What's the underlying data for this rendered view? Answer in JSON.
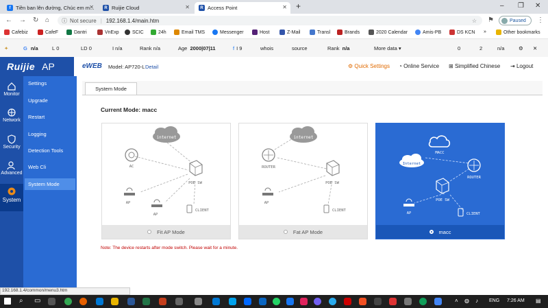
{
  "browser": {
    "tabs": [
      {
        "title": "Tiền ban lên đường, Chúc em m...",
        "icon": "facebook-icon",
        "color": "#1877f2",
        "active": false
      },
      {
        "title": "Ruijie Cloud",
        "icon": "ruijie-icon",
        "color": "#1e50a8",
        "active": false
      },
      {
        "title": "Access Point",
        "icon": "ruijie-icon",
        "color": "#1e50a8",
        "active": true
      }
    ],
    "address": {
      "security": "Not secure",
      "url": "192.168.1.4/main.htm"
    },
    "profile_status": "Paused",
    "bookmarks": [
      "Cafebiz",
      "CafeF",
      "Dantri",
      "VnExp",
      "SCIC",
      "24h",
      "Email TMS",
      "Messenger",
      "Host",
      "Z-Mail",
      "Transl",
      "Brands",
      "2020 Calendar",
      "Amis-PB",
      "DS KCN"
    ],
    "other_bookmarks": "Other bookmarks",
    "status_url": "192.168.1.4/common/menu3.htm"
  },
  "seobar": {
    "items": [
      {
        "label": "",
        "value": "n/a",
        "icon": "google-icon"
      },
      {
        "label": "L",
        "value": "0"
      },
      {
        "label": "LD",
        "value": "0"
      },
      {
        "label": "",
        "value": "I n/a"
      },
      {
        "label": "Rank",
        "value": "n/a"
      },
      {
        "label": "Age",
        "value": "2000|07|11"
      },
      {
        "label": "",
        "value": "I 9"
      },
      {
        "label": "",
        "value": "whois"
      },
      {
        "label": "",
        "value": "source"
      },
      {
        "label": "Rank",
        "value": "n/a"
      }
    ],
    "more": "More data",
    "right": [
      "0",
      "2",
      "n/a"
    ]
  },
  "app": {
    "brand": "Ruijie",
    "brand_suffix": "AP",
    "eweb": "eWEB",
    "model_label": "Model: AP720-L",
    "detail": "Detail",
    "header_links": {
      "quick": "Quick Settings",
      "online": "Online Service",
      "language": "Simplified Chinese",
      "logout": "Logout"
    },
    "rail": [
      {
        "label": "Monitor",
        "icon": "monitor-icon"
      },
      {
        "label": "Network",
        "icon": "network-icon"
      },
      {
        "label": "Security",
        "icon": "security-icon"
      },
      {
        "label": "Advanced",
        "icon": "advanced-icon"
      },
      {
        "label": "System",
        "icon": "system-icon",
        "selected": true
      }
    ],
    "submenu": [
      {
        "label": "Settings"
      },
      {
        "label": "Upgrade"
      },
      {
        "label": "Restart"
      },
      {
        "label": "Logging"
      },
      {
        "label": "Detection Tools"
      },
      {
        "label": "Web Cli"
      },
      {
        "label": "System Mode",
        "selected": true
      }
    ],
    "tab": "System Mode",
    "current_mode_label": "Current Mode:",
    "current_mode_value": "macc",
    "cards": [
      {
        "label": "Fit AP Mode",
        "selected": false,
        "diagram": {
          "cloud": "internet",
          "controller": "AC",
          "switch": "POE SW",
          "ap1": "AP",
          "ap2": "AP",
          "client": "CLIENT"
        }
      },
      {
        "label": "Fat AP Mode",
        "selected": false,
        "diagram": {
          "cloud": "internet",
          "controller": "ROUTER",
          "switch": "POE SW",
          "ap1": "AP",
          "client": "CLIENT"
        }
      },
      {
        "label": "macc",
        "selected": true,
        "diagram": {
          "macc": "MACC",
          "cloud": "Internet",
          "router": "ROUTER",
          "switch": "POE SW",
          "ap1": "AP",
          "client": "CLIENT"
        }
      }
    ],
    "note": "Note: The device restarts after mode switch. Please wait for a minute."
  },
  "taskbar": {
    "lang": "ENG",
    "time": "7:26 AM"
  },
  "colors": {
    "brand_blue": "#1e50a8",
    "accent_orange": "#e06a00",
    "note_red": "#c00000",
    "selected_card": "#2a6bd3"
  }
}
